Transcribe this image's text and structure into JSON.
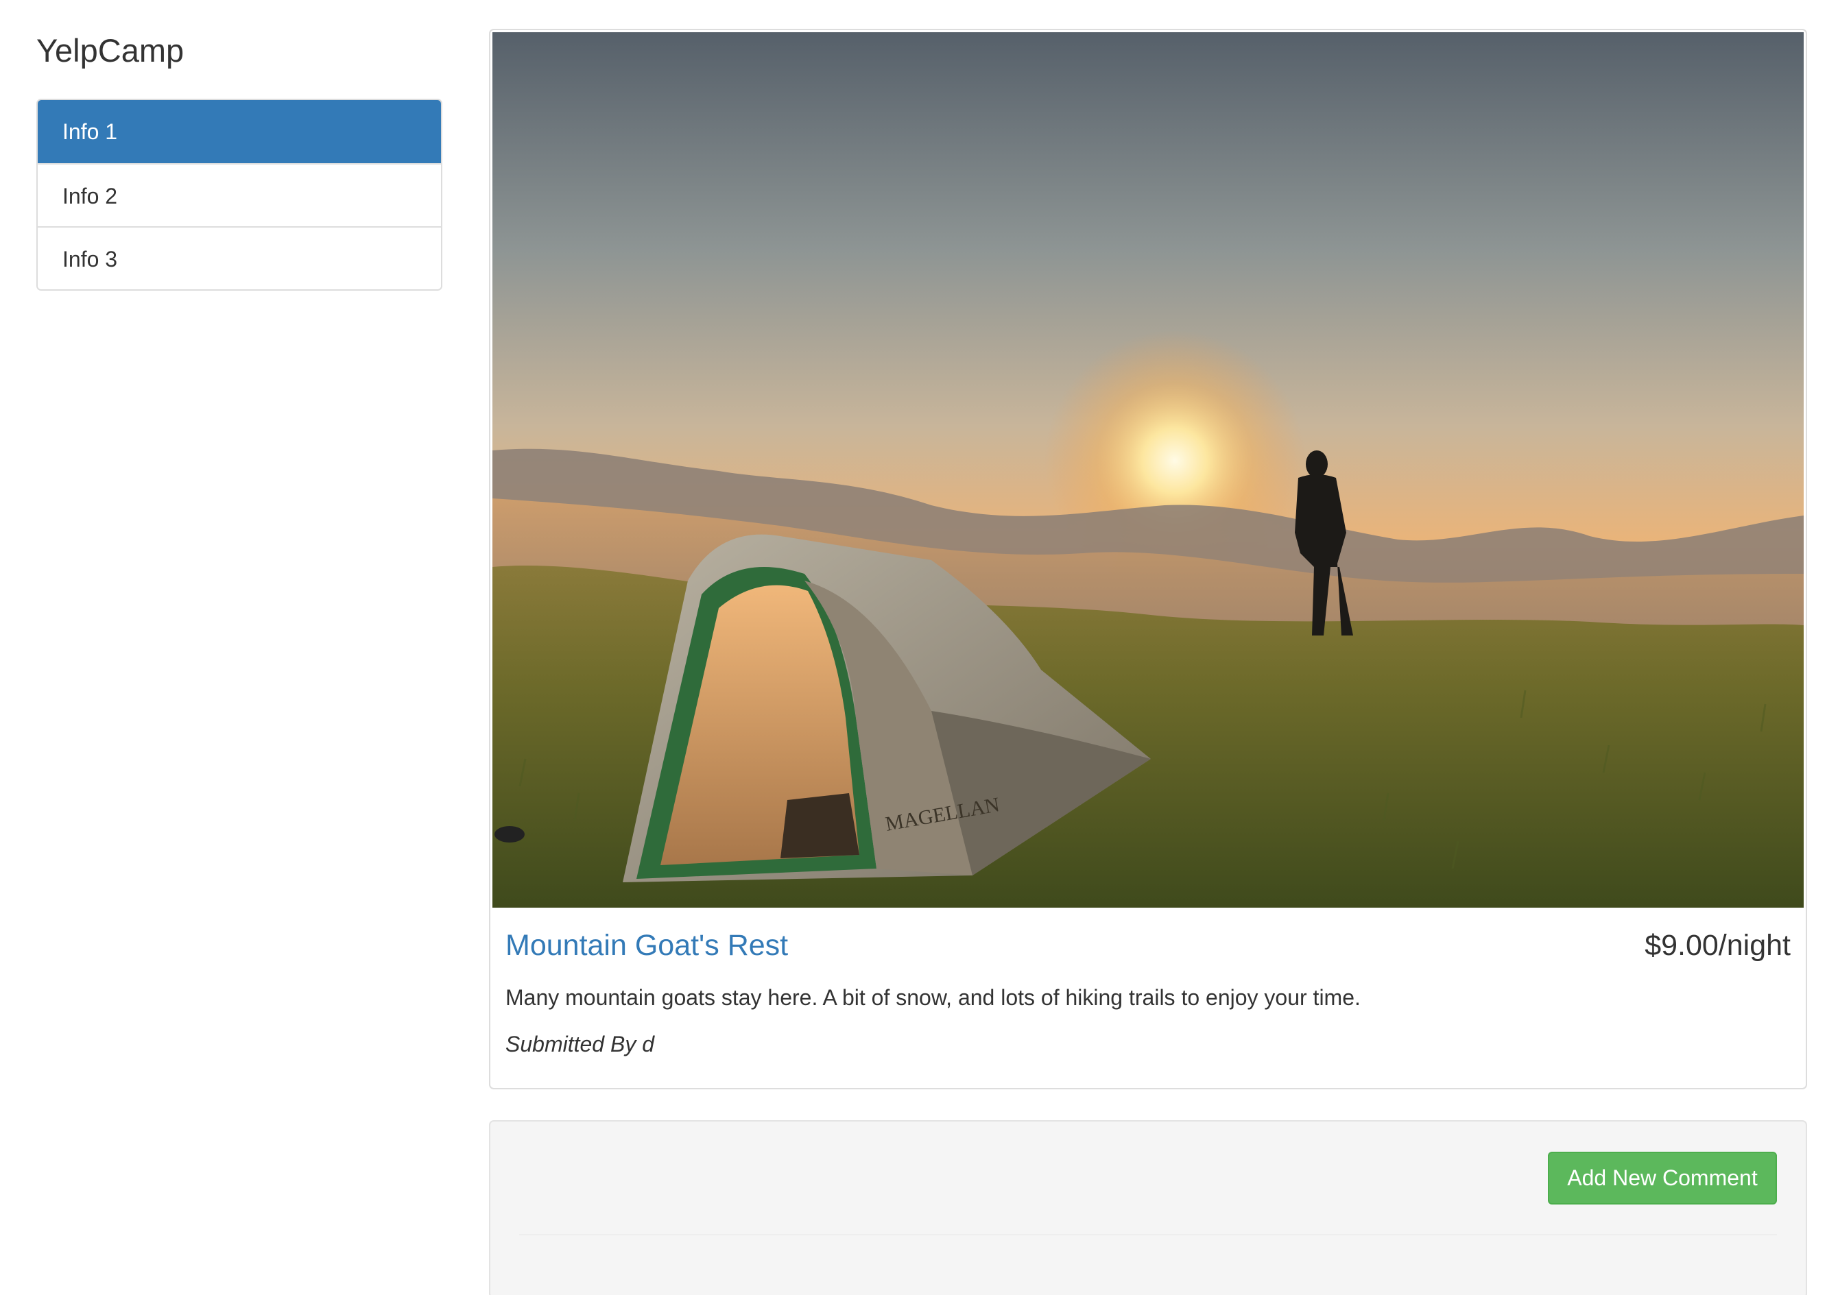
{
  "brand": {
    "title": "YelpCamp"
  },
  "sidebar": {
    "items": [
      {
        "label": "Info 1",
        "active": true
      },
      {
        "label": "Info 2",
        "active": false
      },
      {
        "label": "Info 3",
        "active": false
      }
    ]
  },
  "campground": {
    "name": "Mountain Goat's Rest",
    "price": "$9.00/night",
    "description": "Many mountain goats stay here. A bit of snow, and lots of hiking trails to enjoy your time.",
    "submitted_by": "Submitted By d",
    "image": "campsite-photo",
    "tent_brand": "MAGELLAN"
  },
  "comments": {
    "add_button_label": "Add New Comment"
  },
  "colors": {
    "primary": "#337ab7",
    "success": "#5cb85c",
    "well_bg": "#f5f5f5"
  }
}
